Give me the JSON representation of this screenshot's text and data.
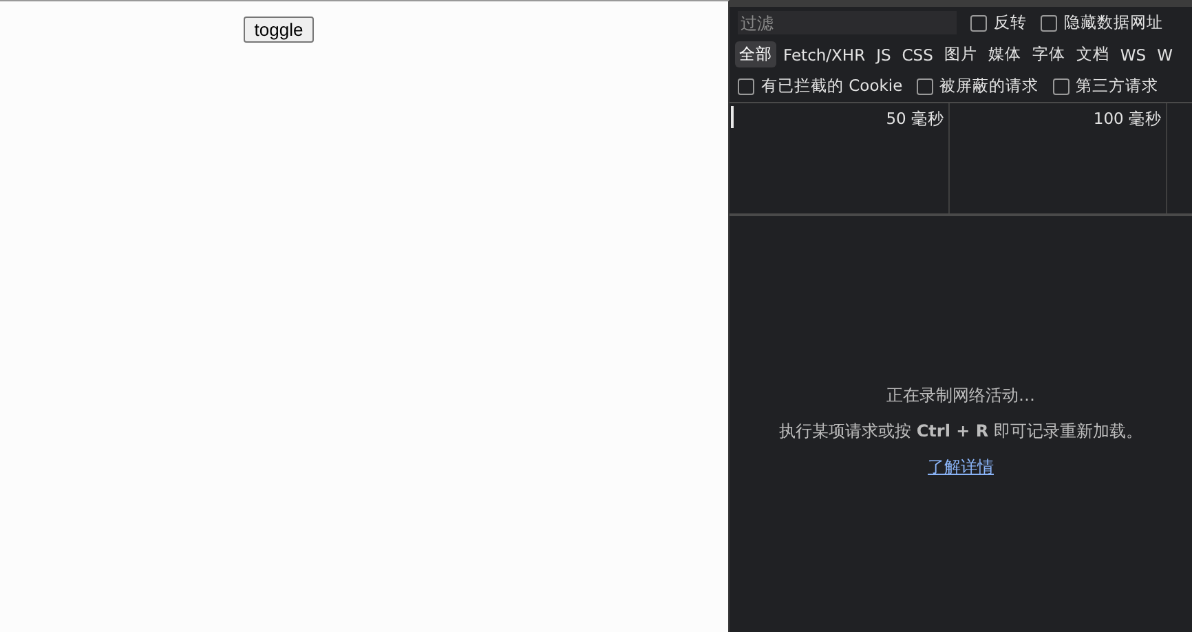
{
  "page": {
    "button": "toggle"
  },
  "devtools": {
    "filter": {
      "placeholder": "过滤"
    },
    "filter_options": [
      {
        "label": "反转",
        "checked": false
      },
      {
        "label": "隐藏数据网址",
        "checked": false
      }
    ],
    "type_tabs": [
      {
        "label": "全部",
        "selected": true
      },
      {
        "label": "Fetch/XHR",
        "selected": false
      },
      {
        "label": "JS",
        "selected": false
      },
      {
        "label": "CSS",
        "selected": false
      },
      {
        "label": "图片",
        "selected": false
      },
      {
        "label": "媒体",
        "selected": false
      },
      {
        "label": "字体",
        "selected": false
      },
      {
        "label": "文档",
        "selected": false
      },
      {
        "label": "WS",
        "selected": false
      },
      {
        "label": "W",
        "selected": false
      }
    ],
    "request_options": [
      {
        "label": "有已拦截的 Cookie",
        "checked": false
      },
      {
        "label": "被屏蔽的请求",
        "checked": false
      },
      {
        "label": "第三方请求",
        "checked": false
      }
    ],
    "timeline": [
      "50 毫秒",
      "100 毫秒"
    ],
    "empty_state": {
      "title": "正在录制网络活动…",
      "hint": "执行某项请求或按 **Ctrl + R** 即可记录重新加载。",
      "link": "了解详情"
    }
  }
}
